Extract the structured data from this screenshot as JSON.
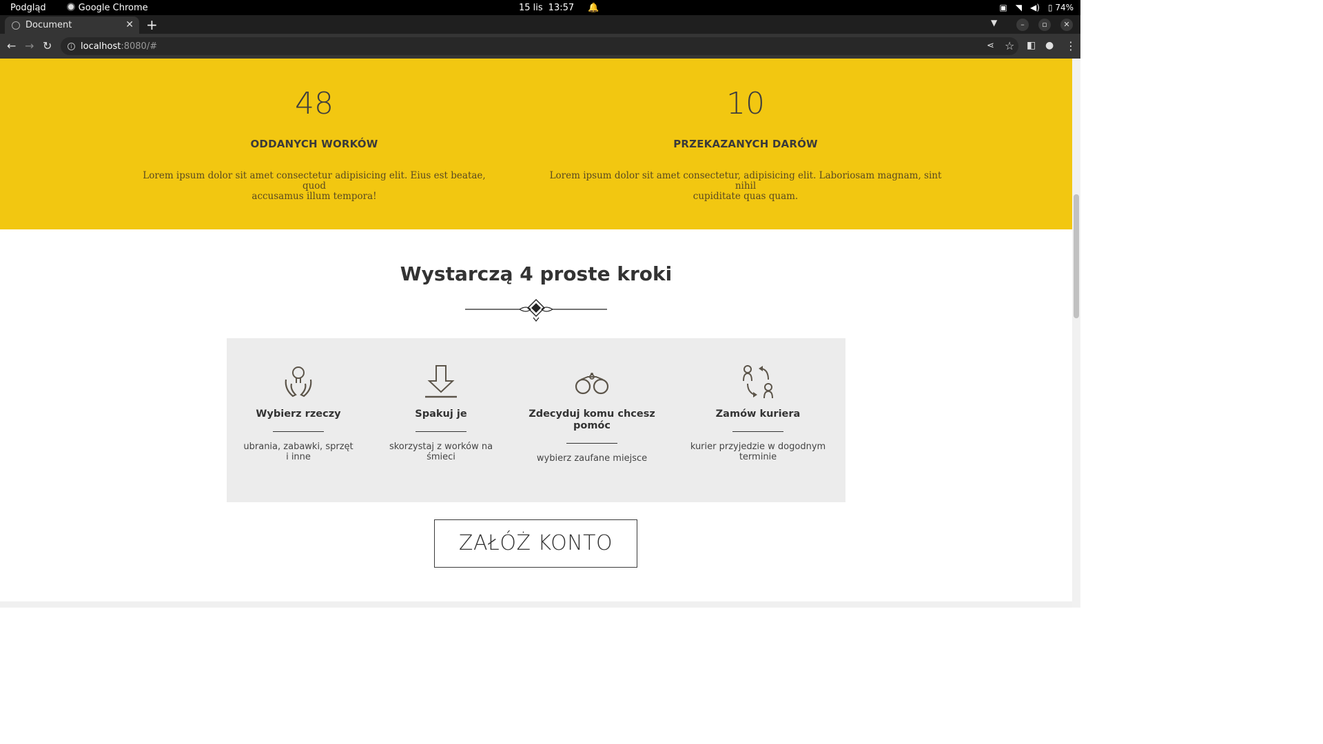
{
  "os": {
    "app_menu": "Podgląd",
    "active_app": "Google Chrome",
    "date": "15 lis",
    "time": "13:57",
    "battery": "74%"
  },
  "browser": {
    "tab_title": "Document",
    "url_host": "localhost",
    "url_rest": ":8080/#"
  },
  "stats": [
    {
      "number": "48",
      "label": "ODDANYCH WORKÓW",
      "desc_line1": "Lorem ipsum dolor sit amet consectetur adipisicing elit. Eius est beatae, quod",
      "desc_line2": "accusamus illum tempora!"
    },
    {
      "number": "10",
      "label": "PRZEKAZANYCH DARÓW",
      "desc_line1": "Lorem ipsum dolor sit amet consectetur, adipisicing elit. Laboriosam magnam, sint nihil",
      "desc_line2": "cupiditate quas quam."
    }
  ],
  "steps_section": {
    "title": "Wystarczą 4 proste kroki",
    "steps": [
      {
        "icon": "hands-lightbulb-icon",
        "title_line1": "Wybierz rzeczy",
        "title_line2": "",
        "desc_line1": "ubrania, zabawki, sprzęt",
        "desc_line2": "i inne"
      },
      {
        "icon": "download-arrow-icon",
        "title_line1": "Spakuj je",
        "title_line2": "",
        "desc_line1": "skorzystaj z worków na",
        "desc_line2": "śmieci"
      },
      {
        "icon": "binoculars-icon",
        "title_line1": "Zdecyduj komu chcesz",
        "title_line2": "pomóc",
        "desc_line1": "wybierz zaufane miejsce",
        "desc_line2": ""
      },
      {
        "icon": "people-exchange-icon",
        "title_line1": "Zamów kuriera",
        "title_line2": "",
        "desc_line1": "kurier przyjedzie w dogodnym",
        "desc_line2": "terminie"
      }
    ]
  },
  "cta": {
    "label": "ZAŁÓŻ KONTO"
  }
}
